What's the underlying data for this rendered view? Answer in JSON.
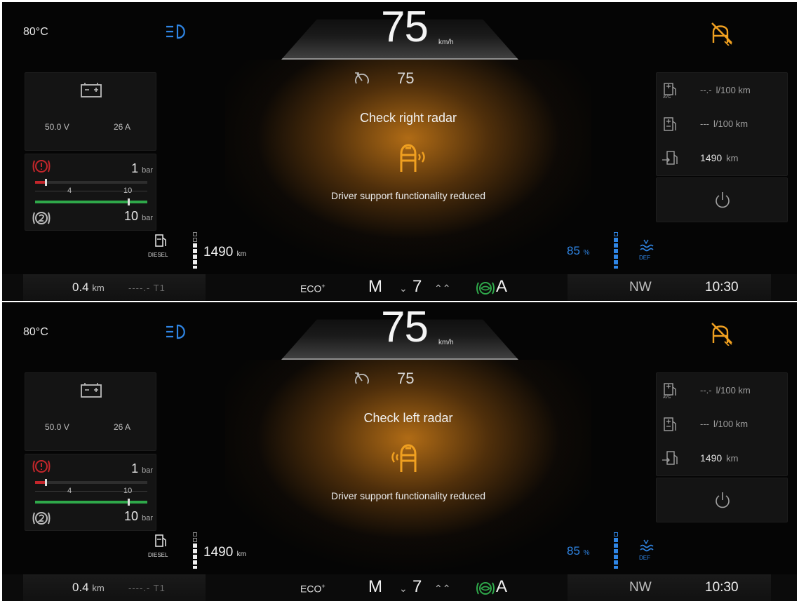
{
  "colors": {
    "accent_amber": "#f0a020",
    "accent_blue": "#2f86e6",
    "warning_red": "#c3262b",
    "gauge_green": "#2fa84a"
  },
  "clusters": [
    {
      "temperature": "80°C",
      "speed": "75",
      "speed_unit": "km/h",
      "set_speed": "75",
      "message_title": "Check right radar",
      "message_subtitle": "Driver support functionality reduced",
      "message_icon": "radar-right-warning-icon",
      "battery": {
        "voltage": "50.0 V",
        "current": "26 A"
      },
      "air_pressure": {
        "circuit1": {
          "value": "1",
          "unit": "bar",
          "level": 0.1
        },
        "circuit2": {
          "value": "10",
          "unit": "bar",
          "level": 1.0
        },
        "scale_labels": [
          "4",
          "10"
        ]
      },
      "fuel_info": {
        "avg_consumption": {
          "value": "--.-",
          "unit": "l/100 km"
        },
        "inst_consumption": {
          "value": "---",
          "unit": "l/100 km"
        },
        "range": {
          "value": "1490",
          "unit": "km"
        }
      },
      "diesel_label": "DIESEL",
      "fuel_range": {
        "value": "1490",
        "unit": "km"
      },
      "def": {
        "value": "85",
        "unit": "%",
        "label": "DEF"
      },
      "trip": {
        "value": "0.4",
        "unit": "km",
        "t1": "----.- T1"
      },
      "eco": {
        "text": "ECO",
        "mark": "+"
      },
      "gear": {
        "mode": "M",
        "down": "⌄",
        "number": "7",
        "up": "⌃⌃"
      },
      "auto_mode": "A",
      "compass": "NW",
      "clock": "10:30"
    },
    {
      "temperature": "80°C",
      "speed": "75",
      "speed_unit": "km/h",
      "set_speed": "75",
      "message_title": "Check left radar",
      "message_subtitle": "Driver support functionality reduced",
      "message_icon": "radar-left-warning-icon",
      "battery": {
        "voltage": "50.0 V",
        "current": "26 A"
      },
      "air_pressure": {
        "circuit1": {
          "value": "1",
          "unit": "bar",
          "level": 0.1
        },
        "circuit2": {
          "value": "10",
          "unit": "bar",
          "level": 1.0
        },
        "scale_labels": [
          "4",
          "10"
        ]
      },
      "fuel_info": {
        "avg_consumption": {
          "value": "--.-",
          "unit": "l/100 km"
        },
        "inst_consumption": {
          "value": "---",
          "unit": "l/100 km"
        },
        "range": {
          "value": "1490",
          "unit": "km"
        }
      },
      "diesel_label": "DIESEL",
      "fuel_range": {
        "value": "1490",
        "unit": "km"
      },
      "def": {
        "value": "85",
        "unit": "%",
        "label": "DEF"
      },
      "trip": {
        "value": "0.4",
        "unit": "km",
        "t1": "----.- T1"
      },
      "eco": {
        "text": "ECO",
        "mark": "+"
      },
      "gear": {
        "mode": "M",
        "down": "⌄",
        "number": "7",
        "up": "⌃⌃"
      },
      "auto_mode": "A",
      "compass": "NW",
      "clock": "10:30"
    }
  ]
}
